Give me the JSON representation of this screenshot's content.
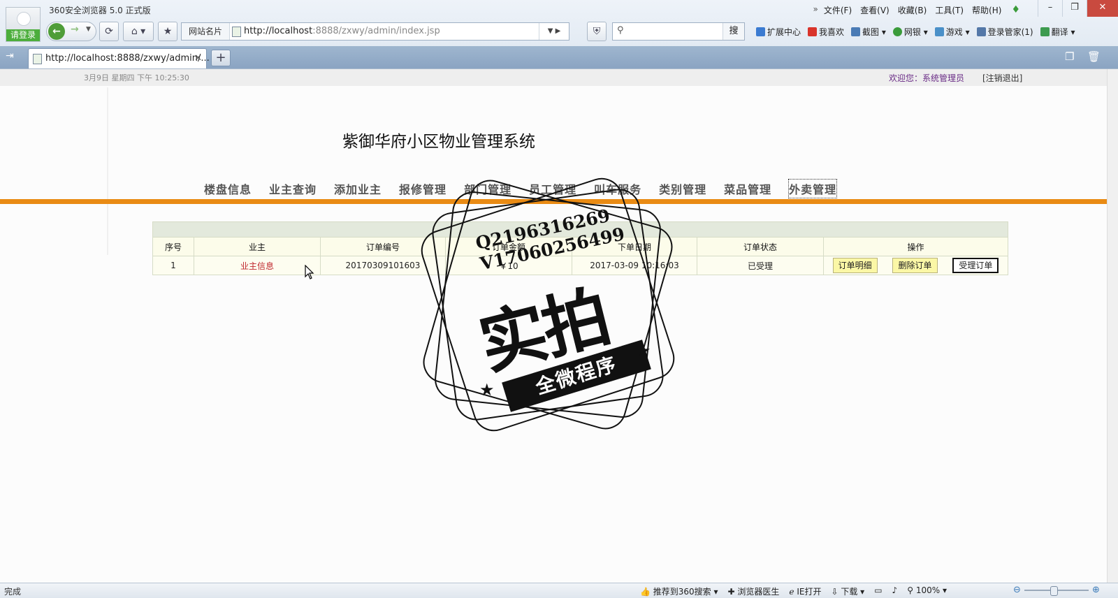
{
  "browser": {
    "app_title": "360安全浏览器 5.0 正式版",
    "login_label": "请登录",
    "menu": [
      "文件(F)",
      "查看(V)",
      "收藏(B)",
      "工具(T)",
      "帮助(H)"
    ],
    "site_card": "网站名片",
    "url_host": "http://localhost",
    "url_rest": ":8888/zxwy/admin/index.jsp",
    "search_button": "搜",
    "extensions": [
      "扩展中心",
      "我喜欢",
      "截图",
      "网银",
      "游戏",
      "登录管家(1)",
      "翻译"
    ],
    "tab_title": "http://localhost:8888/zxwy/admin/...",
    "status_done": "完成",
    "status_items": [
      "推荐到360搜索",
      "浏览器医生",
      "IE打开",
      "下载"
    ],
    "zoom": "100%",
    "colors": {
      "accent_green": "#4cae3c",
      "tabbar": "#8aa4c2"
    }
  },
  "page": {
    "date": "3月9日  星期四  下午  10:25:30",
    "welcome": "欢迎您：系统管理员",
    "logout": "[注销退出]",
    "system_title": "紫御华府小区物业管理系统",
    "nav": [
      {
        "label": "楼盘信息"
      },
      {
        "label": "业主查询"
      },
      {
        "label": "添加业主"
      },
      {
        "label": "报修管理"
      },
      {
        "label": "部门管理"
      },
      {
        "label": "员工管理"
      },
      {
        "label": "叫车服务"
      },
      {
        "label": "类别管理"
      },
      {
        "label": "菜品管理"
      },
      {
        "label": "外卖管理",
        "active": true
      }
    ],
    "accent_color": "#e98b14",
    "table": {
      "headers": [
        "序号",
        "业主",
        "订单编号",
        "订单金额",
        "下单日期",
        "订单状态",
        "操作"
      ],
      "rows": [
        {
          "index": "1",
          "owner": "业主信息",
          "order_no": "20170309101603",
          "amount": "￥10",
          "date": "2017-03-09 10:16:03",
          "status": "已受理",
          "actions": [
            "订单明细",
            "删除订单",
            "受理订单"
          ]
        }
      ]
    }
  },
  "watermark": {
    "qq": "Q2196316269",
    "v": "V17060256499",
    "big": "实拍",
    "ribbon": "全微程序"
  }
}
